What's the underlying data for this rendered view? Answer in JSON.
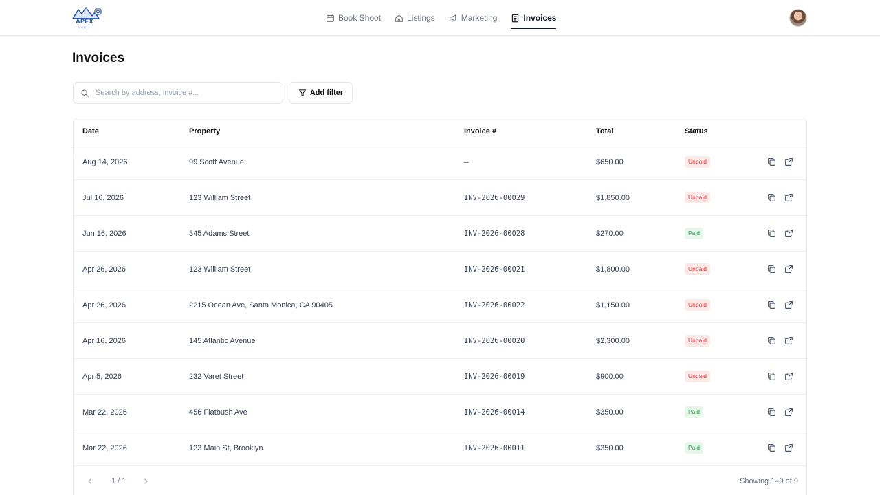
{
  "brand": {
    "name": "APEX",
    "sub": "MEDIA"
  },
  "nav": [
    {
      "label": "Book Shoot",
      "icon": "calendar-icon",
      "active": false
    },
    {
      "label": "Listings",
      "icon": "house-icon",
      "active": false
    },
    {
      "label": "Marketing",
      "icon": "megaphone-icon",
      "active": false
    },
    {
      "label": "Invoices",
      "icon": "invoice-icon",
      "active": true
    }
  ],
  "page": {
    "title": "Invoices"
  },
  "search": {
    "placeholder": "Search by address, invoice #..."
  },
  "filter": {
    "label": "Add filter"
  },
  "table": {
    "headers": [
      "Date",
      "Property",
      "Invoice #",
      "Total",
      "Status"
    ],
    "rows": [
      {
        "date": "Aug 14, 2026",
        "property": "99 Scott Avenue",
        "invoice": "–",
        "total": "$650.00",
        "status": "Unpaid"
      },
      {
        "date": "Jul 16, 2026",
        "property": "123 William Street",
        "invoice": "INV-2026-00029",
        "total": "$1,850.00",
        "status": "Unpaid"
      },
      {
        "date": "Jun 16, 2026",
        "property": "345 Adams Street",
        "invoice": "INV-2026-00028",
        "total": "$270.00",
        "status": "Paid"
      },
      {
        "date": "Apr 26, 2026",
        "property": "123 William Street",
        "invoice": "INV-2026-00021",
        "total": "$1,800.00",
        "status": "Unpaid"
      },
      {
        "date": "Apr 26, 2026",
        "property": "2215 Ocean Ave, Santa Monica, CA 90405",
        "invoice": "INV-2026-00022",
        "total": "$1,150.00",
        "status": "Unpaid"
      },
      {
        "date": "Apr 16, 2026",
        "property": "145 Atlantic Avenue",
        "invoice": "INV-2026-00020",
        "total": "$2,300.00",
        "status": "Unpaid"
      },
      {
        "date": "Apr 5, 2026",
        "property": "232 Varet Street",
        "invoice": "INV-2026-00019",
        "total": "$900.00",
        "status": "Unpaid"
      },
      {
        "date": "Mar 22, 2026",
        "property": "456 Flatbush Ave",
        "invoice": "INV-2026-00014",
        "total": "$350.00",
        "status": "Paid"
      },
      {
        "date": "Mar 22, 2026",
        "property": "123 Main St, Brooklyn",
        "invoice": "INV-2026-00011",
        "total": "$350.00",
        "status": "Paid"
      }
    ]
  },
  "pagination": {
    "page_text": "1 / 1",
    "showing": "Showing 1–9 of 9"
  }
}
